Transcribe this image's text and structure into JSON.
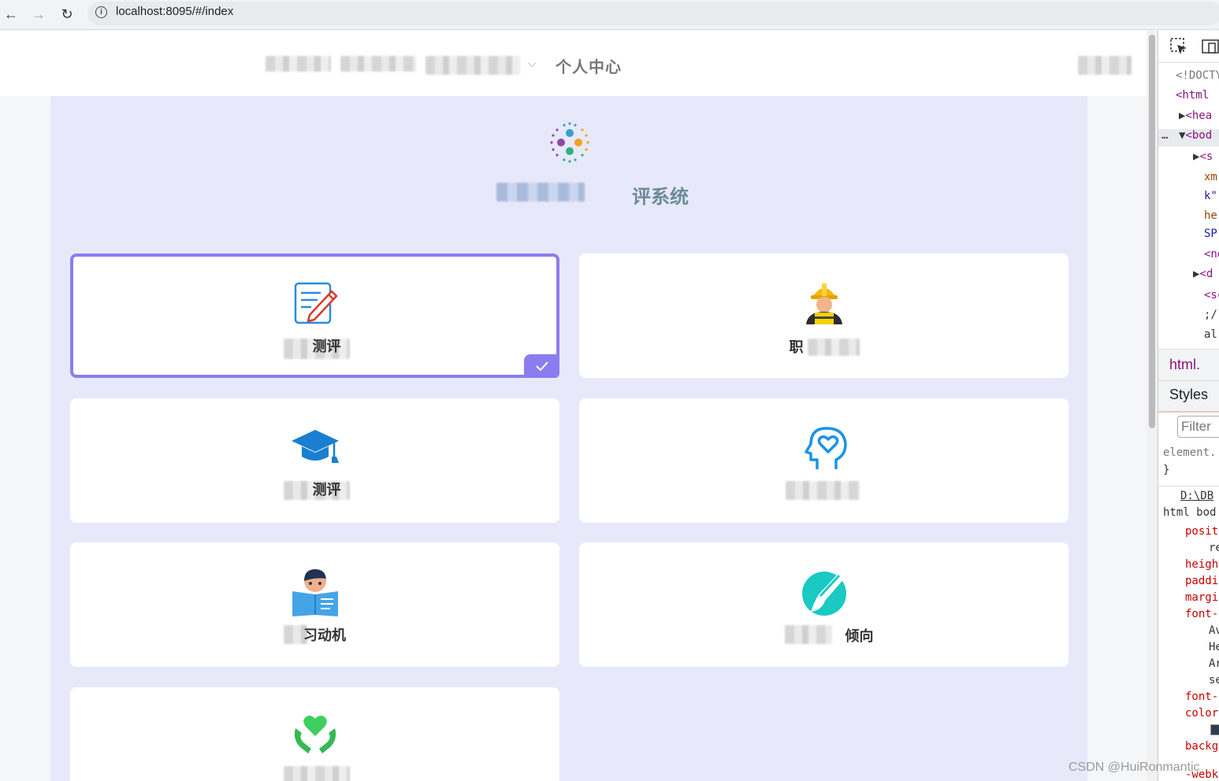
{
  "browser": {
    "url": "localhost:8095/#/index",
    "back_label": "←",
    "forward_label": "→",
    "reload_label": "↻",
    "info_label": "i"
  },
  "nav": {
    "personal_center": "个人中心",
    "chevron": "⌵"
  },
  "header": {
    "system_title_suffix": "评系统"
  },
  "cards": [
    {
      "label": "测评",
      "selected": true,
      "icon": "notepad-pencil-icon"
    },
    {
      "label": "职",
      "selected": false,
      "icon": "worker-helmet-icon"
    },
    {
      "label": "测评",
      "selected": false,
      "icon": "graduation-cap-icon"
    },
    {
      "label": "",
      "selected": false,
      "icon": "head-heart-icon"
    },
    {
      "label": "习动机",
      "selected": false,
      "icon": "reading-student-icon"
    },
    {
      "label": "倾向",
      "selected": false,
      "icon": "paintbrush-icon"
    },
    {
      "label": "",
      "selected": false,
      "icon": "hands-heart-icon"
    }
  ],
  "devtools": {
    "elements": [
      "<!DOCTY",
      "<html",
      "<hea",
      "<bod",
      "<s",
      "xm",
      "k\"",
      "he",
      "SP",
      "<no",
      "<d",
      "<sc",
      ";/",
      "al"
    ],
    "tab_html": "html.",
    "tab_styles": "Styles",
    "filter_placeholder": "Filter",
    "element_selector": "element.",
    "close_brace": "}",
    "source_path": "D:\\DB",
    "rule_selector": "html bod",
    "props": [
      "posit",
      "re",
      "heigh",
      "paddi",
      "margi",
      "font-",
      "Av",
      "He",
      "Ar",
      "se",
      "font-",
      "color",
      "backg",
      "-webk"
    ]
  },
  "watermark": "CSDN @HuiRonmantic"
}
